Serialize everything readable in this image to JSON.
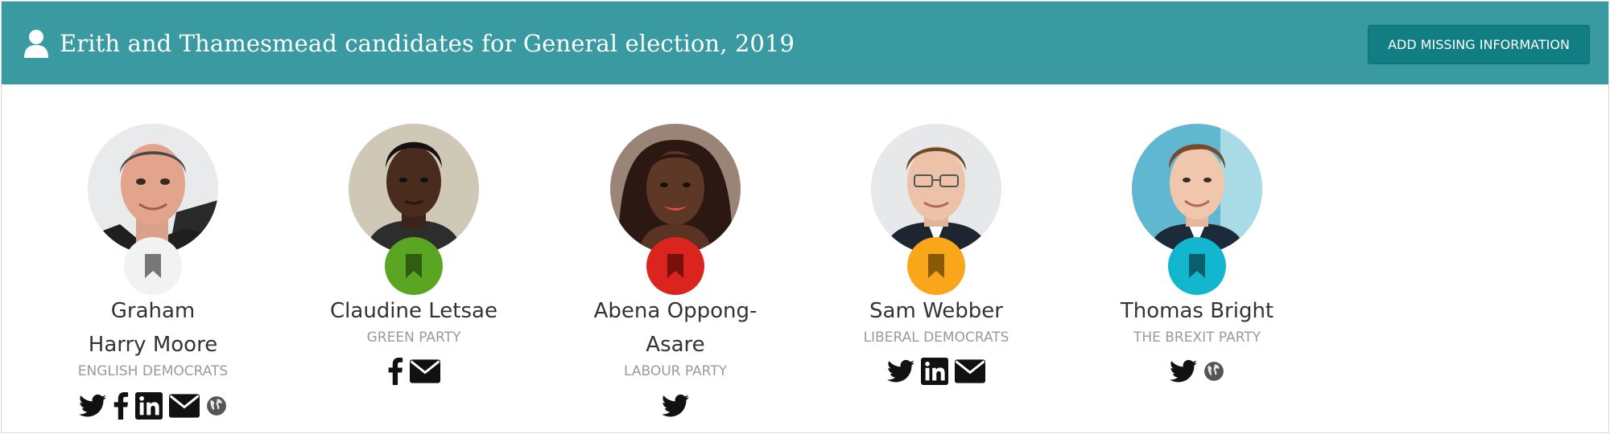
{
  "header": {
    "title": "Erith and Thamesmead candidates for General election, 2019",
    "button_label": "ADD MISSING INFORMATION",
    "background": "#3a9aa1",
    "button_color": "#117e84"
  },
  "candidates": [
    {
      "name": "Graham Harry Moore",
      "party": "ENGLISH DEMOCRATS",
      "party_color": "#f2f2f2",
      "badge_icon_color": "#777777",
      "socials": [
        "twitter-icon",
        "facebook-icon",
        "linkedin-icon",
        "email-icon",
        "website-icon"
      ]
    },
    {
      "name": "Claudine Letsae",
      "party": "GREEN PARTY",
      "party_color": "#5aa623",
      "badge_icon_color": "#2f5e11",
      "socials": [
        "facebook-icon",
        "email-icon"
      ]
    },
    {
      "name": "Abena Oppong-Asare",
      "party": "LABOUR PARTY",
      "party_color": "#dc241f",
      "badge_icon_color": "#7a100c",
      "socials": [
        "twitter-icon"
      ]
    },
    {
      "name": "Sam Webber",
      "party": "LIBERAL DEMOCRATS",
      "party_color": "#faa61a",
      "badge_icon_color": "#8a5a08",
      "socials": [
        "twitter-icon",
        "linkedin-icon",
        "email-icon"
      ]
    },
    {
      "name": "Thomas Bright",
      "party": "THE BREXIT PARTY",
      "party_color": "#12b6cf",
      "badge_icon_color": "#0a5f6d",
      "socials": [
        "twitter-icon",
        "website-icon"
      ]
    }
  ]
}
